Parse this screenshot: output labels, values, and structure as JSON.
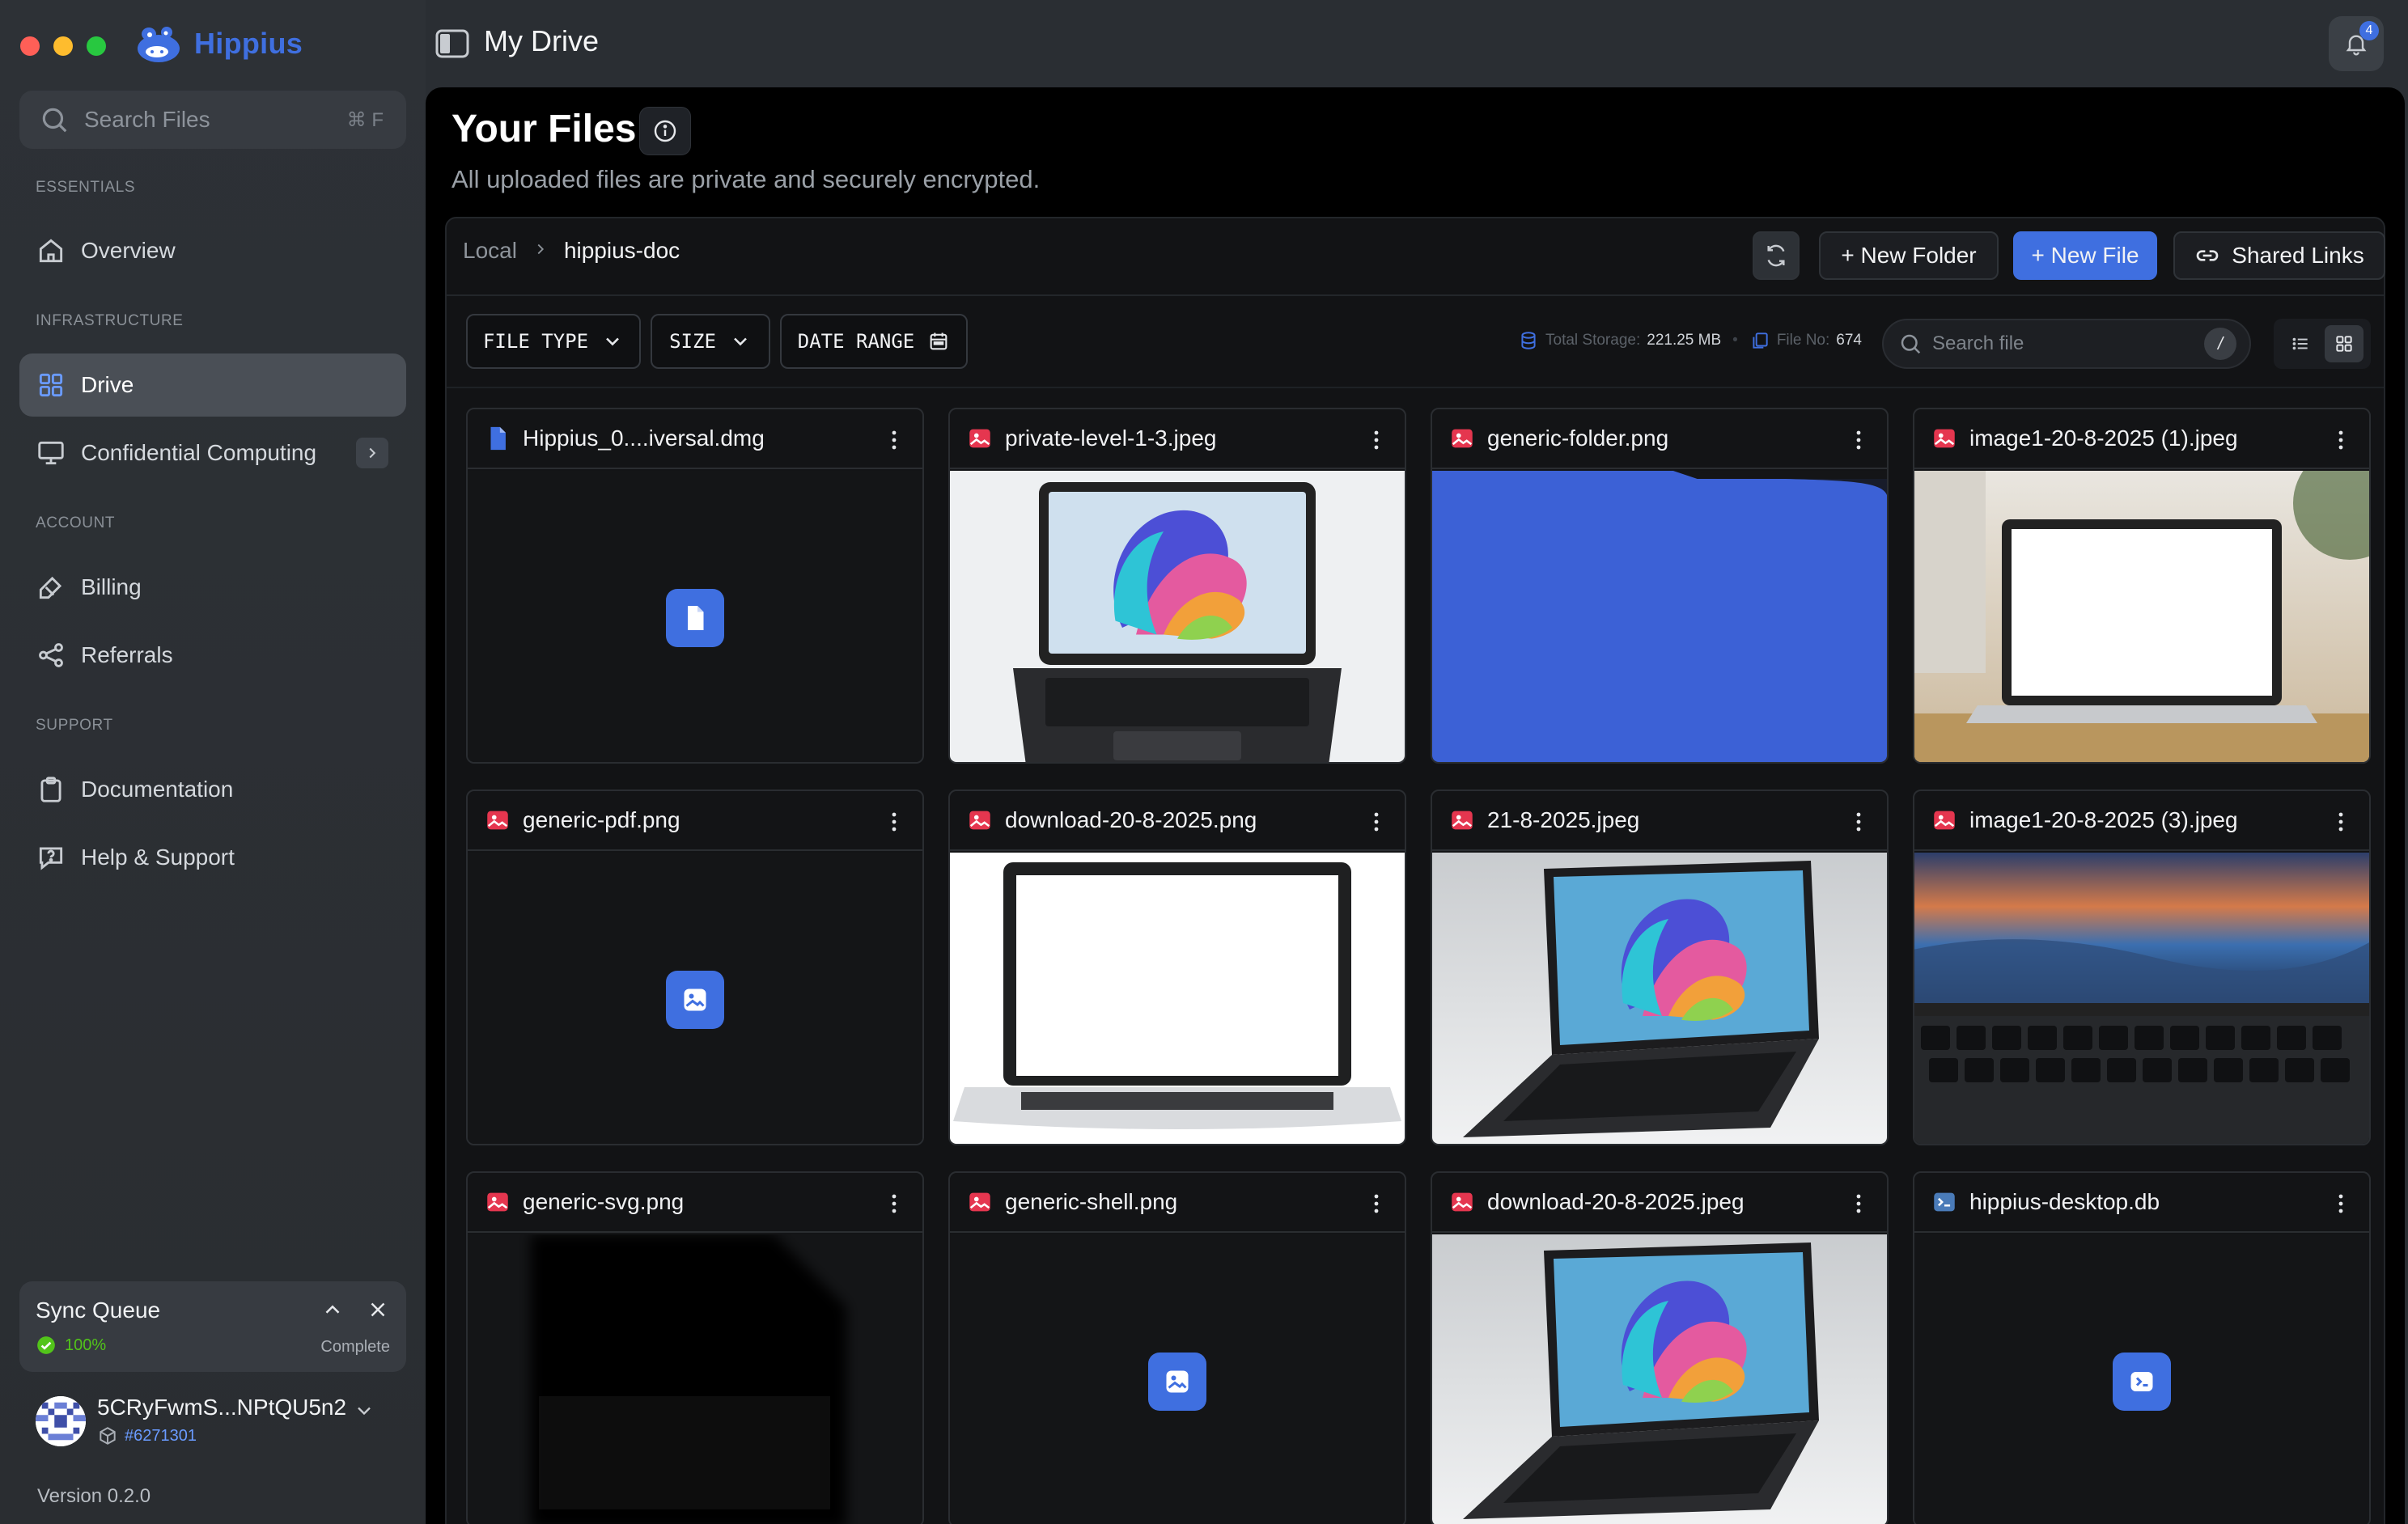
{
  "app": {
    "name": "Hippius",
    "window_title": "My Drive",
    "notification_count": "4",
    "accent": "#3f6fe0"
  },
  "sidebar": {
    "search_placeholder": "Search Files",
    "search_shortcut": "⌘ F",
    "sections": {
      "essentials": "ESSENTIALS",
      "infrastructure": "INFRASTRUCTURE",
      "account": "ACCOUNT",
      "support": "SUPPORT"
    },
    "items": [
      {
        "label": "Overview",
        "icon": "home-icon"
      },
      {
        "label": "Drive",
        "icon": "grid-icon",
        "active": true
      },
      {
        "label": "Confidential Computing",
        "icon": "monitor-icon"
      },
      {
        "label": "Billing",
        "icon": "card-icon"
      },
      {
        "label": "Referrals",
        "icon": "share-icon"
      },
      {
        "label": "Documentation",
        "icon": "clipboard-icon"
      },
      {
        "label": "Help & Support",
        "icon": "help-icon"
      }
    ],
    "sync": {
      "title": "Sync Queue",
      "percent": "100%",
      "status": "Complete"
    },
    "account": {
      "name": "5CRyFwmS...NPtQU5n2",
      "id": "#6271301"
    },
    "version": "Version 0.2.0"
  },
  "main": {
    "title": "Your Files",
    "subtitle": "All uploaded files are private and securely encrypted.",
    "breadcrumb": {
      "root": "Local",
      "current": "hippius-doc"
    },
    "buttons": {
      "new_folder": "+ New Folder",
      "new_file": "+ New File",
      "shared_links": "Shared Links"
    },
    "filters": {
      "file_type": "FILE TYPE",
      "size": "SIZE",
      "date_range": "DATE RANGE"
    },
    "stats": {
      "storage_label": "Total Storage:",
      "storage_value": "221.25 MB",
      "count_label": "File No:",
      "count_value": "674"
    },
    "search_placeholder": "Search file",
    "search_shortcut": "/",
    "files": [
      {
        "name": "Hippius_0....iversal.dmg",
        "kind": "doc",
        "preview": "icon-doc"
      },
      {
        "name": "private-level-1-3.jpeg",
        "kind": "image",
        "preview": "laptop-swirl-front"
      },
      {
        "name": "generic-folder.png",
        "kind": "image",
        "preview": "blue-folder"
      },
      {
        "name": "image1-20-8-2025 (1).jpeg",
        "kind": "image",
        "preview": "laptop-white-desk"
      },
      {
        "name": "generic-pdf.png",
        "kind": "image",
        "preview": "icon-image"
      },
      {
        "name": "download-20-8-2025.png",
        "kind": "image",
        "preview": "laptop-white-screen"
      },
      {
        "name": "21-8-2025.jpeg",
        "kind": "image",
        "preview": "laptop-swirl-angle"
      },
      {
        "name": "image1-20-8-2025 (3).jpeg",
        "kind": "image",
        "preview": "macbook-sunset"
      },
      {
        "name": "generic-svg.png",
        "kind": "image",
        "preview": "svg-blur"
      },
      {
        "name": "generic-shell.png",
        "kind": "image",
        "preview": "icon-image"
      },
      {
        "name": "download-20-8-2025.jpeg",
        "kind": "image",
        "preview": "laptop-swirl-angle"
      },
      {
        "name": "hippius-desktop.db",
        "kind": "shell",
        "preview": "icon-shell"
      }
    ]
  }
}
